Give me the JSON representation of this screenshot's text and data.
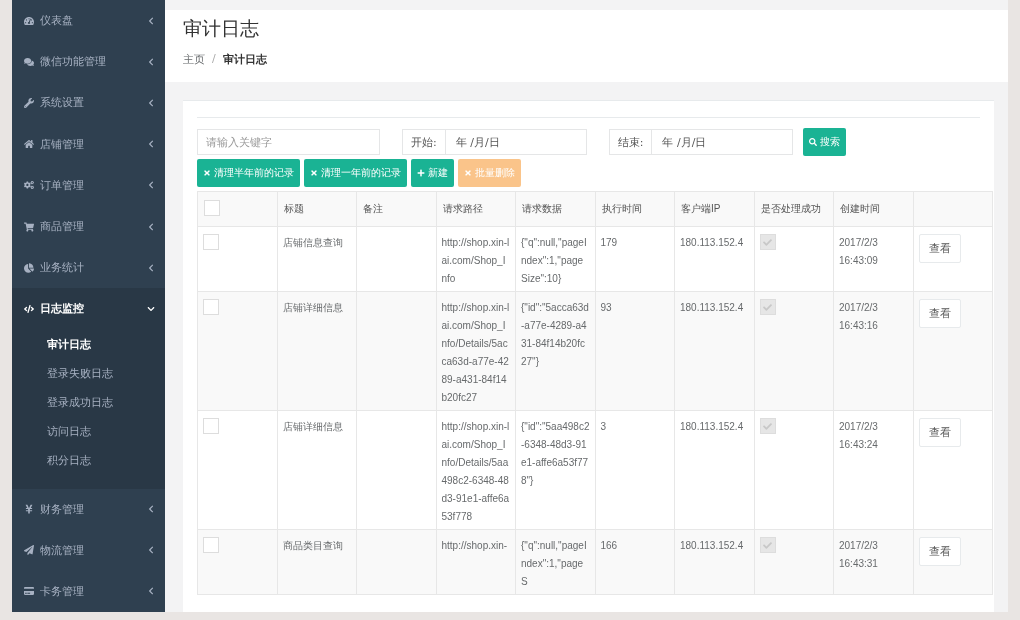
{
  "sidebar": {
    "items": [
      {
        "label": "仪表盘",
        "expanded": false
      },
      {
        "label": "微信功能管理",
        "expanded": false
      },
      {
        "label": "系统设置",
        "expanded": false
      },
      {
        "label": "店铺管理",
        "expanded": false
      },
      {
        "label": "订单管理",
        "expanded": false
      },
      {
        "label": "商品管理",
        "expanded": false
      },
      {
        "label": "业务统计",
        "expanded": false
      },
      {
        "label": "日志监控",
        "expanded": true,
        "children": [
          {
            "label": "审计日志",
            "selected": true
          },
          {
            "label": "登录失败日志",
            "selected": false
          },
          {
            "label": "登录成功日志",
            "selected": false
          },
          {
            "label": "访问日志",
            "selected": false
          },
          {
            "label": "积分日志",
            "selected": false
          }
        ]
      },
      {
        "label": "财务管理",
        "expanded": false
      },
      {
        "label": "物流管理",
        "expanded": false
      },
      {
        "label": "卡务管理",
        "expanded": false
      }
    ]
  },
  "header": {
    "title": "审计日志",
    "breadcrumb": [
      {
        "label": "主页",
        "selected": false
      },
      {
        "label": "审计日志",
        "selected": true
      }
    ],
    "separator": "/"
  },
  "filters": {
    "keyword": {
      "placeholder": "请输入关键字"
    },
    "start": {
      "label": "开始:",
      "placeholder": "年 /月/日"
    },
    "end": {
      "label": "结束:",
      "placeholder": "年 /月/日"
    },
    "search_button": "搜索"
  },
  "actions": [
    {
      "label": "清理半年前的记录",
      "kind": "clear",
      "disabled": false
    },
    {
      "label": "清理一年前的记录",
      "kind": "clear",
      "disabled": false
    },
    {
      "label": "新建",
      "kind": "add",
      "disabled": false
    },
    {
      "label": "批量删除",
      "kind": "delete",
      "disabled": true
    }
  ],
  "table": {
    "select_all": {
      "checked": false
    },
    "columns": [
      "标题",
      "备注",
      "请求路径",
      "请求数据",
      "执行时间",
      "客户端IP",
      "是否处理成功",
      "创建时间"
    ],
    "rows": [
      {
        "selected": false,
        "title": "店铺信息查询",
        "path": "http://shop.xin-lai.com/Shop_Info",
        "data": "{\"q\":null,\"pageIndex\":1,\"pageSize\":10}",
        "time": "179",
        "ip": "180.113.152.4",
        "success": true,
        "created": "2017/2/3 16:43:09",
        "action": "查看"
      },
      {
        "selected": false,
        "title": "店铺详细信息",
        "path": "http://shop.xin-lai.com/Shop_Info/Details/5acca63d-a77e-4289-a431-84f14b20fc27",
        "data": "{\"id\":\"5acca63d-a77e-4289-a431-84f14b20fc27\"}",
        "time": "93",
        "ip": "180.113.152.4",
        "success": true,
        "created": "2017/2/3 16:43:16",
        "action": "查看"
      },
      {
        "selected": false,
        "title": "店铺详细信息",
        "path": "http://shop.xin-lai.com/Shop_Info/Details/5aa498c2-6348-48d3-91e1-affe6a53f778",
        "data": "{\"id\":\"5aa498c2-6348-48d3-91e1-affe6a53f778\"}",
        "time": "3",
        "ip": "180.113.152.4",
        "success": true,
        "created": "2017/2/3 16:43:24",
        "action": "查看"
      },
      {
        "selected": false,
        "title": "商品类目查询",
        "path": "http://shop.xin-",
        "data": "{\"q\":null,\"pageIndex\":1,\"pageS",
        "time": "166",
        "ip": "180.113.152.4",
        "success": true,
        "created": "2017/2/3 16:43:31",
        "action": "查看"
      }
    ]
  }
}
